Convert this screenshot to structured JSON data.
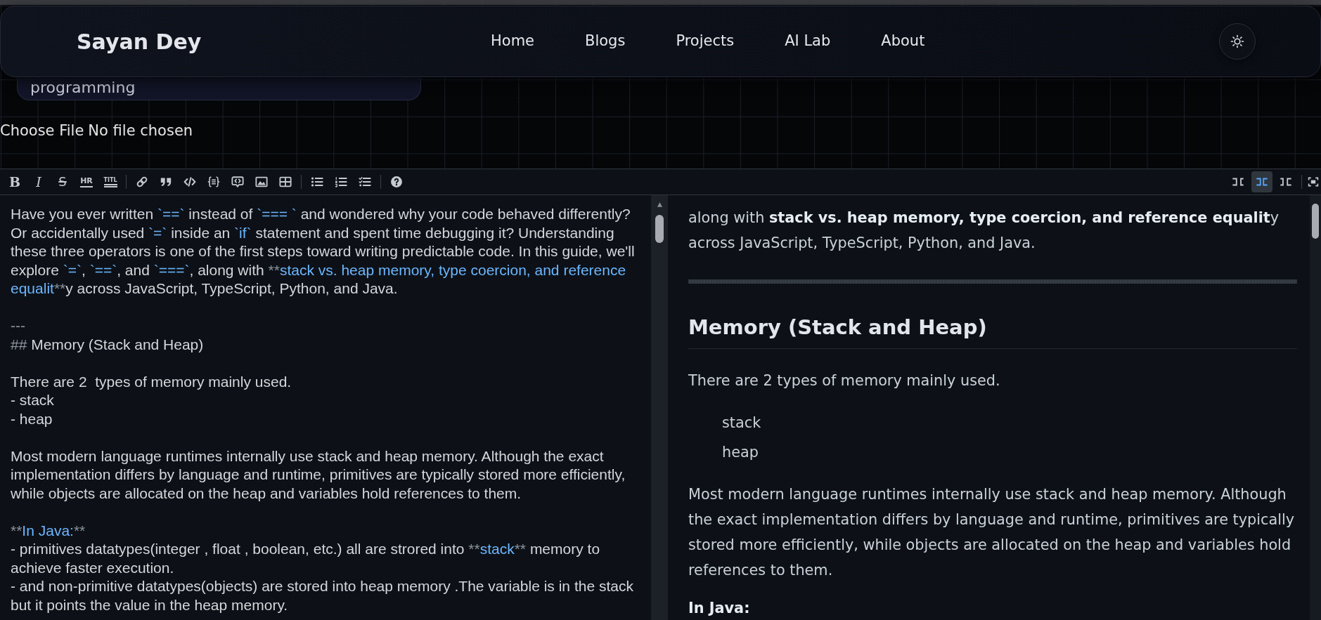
{
  "header": {
    "brand": "Sayan Dey",
    "nav": [
      "Home",
      "Blogs",
      "Projects",
      "AI Lab",
      "About"
    ]
  },
  "dropdown": {
    "items": [
      "programming"
    ]
  },
  "file_input": {
    "button": "Choose File",
    "status": "No file chosen"
  },
  "toolbar": {
    "groups": [
      [
        {
          "kind": "bold",
          "glyph": "B"
        },
        {
          "kind": "italic",
          "glyph": "I"
        },
        {
          "kind": "strikethrough",
          "glyph": "S"
        },
        {
          "kind": "rule",
          "glyph": "HR"
        },
        {
          "kind": "title",
          "glyph": "TITL"
        }
      ],
      [
        {
          "kind": "link"
        },
        {
          "kind": "quote"
        },
        {
          "kind": "code"
        },
        {
          "kind": "code_block"
        },
        {
          "kind": "comment"
        },
        {
          "kind": "image"
        },
        {
          "kind": "table"
        }
      ],
      [
        {
          "kind": "unordered_list"
        },
        {
          "kind": "ordered_list"
        },
        {
          "kind": "checked_list"
        }
      ],
      [
        {
          "kind": "help"
        }
      ]
    ],
    "view_modes": [
      {
        "kind": "edit",
        "selected": false
      },
      {
        "kind": "live",
        "selected": true
      },
      {
        "kind": "preview",
        "selected": false
      }
    ]
  },
  "editor": {
    "lines": [
      {
        "kind": "text",
        "segments": [
          {
            "kind": "text",
            "text": "Have you ever written "
          },
          {
            "kind": "code",
            "text": "`==`"
          },
          {
            "kind": "text",
            "text": " instead of "
          },
          {
            "kind": "code",
            "text": "`=== `"
          },
          {
            "kind": "text",
            "text": " and wondered why your code behaved differently? Or accidentally used "
          },
          {
            "kind": "code",
            "text": "`=`"
          },
          {
            "kind": "text",
            "text": " inside an "
          },
          {
            "kind": "code",
            "text": "`if`"
          },
          {
            "kind": "text",
            "text": " statement and spent time debugging it? Understanding these three operators is one of the first steps toward writing predictable code. In this guide, we'll explore "
          },
          {
            "kind": "code",
            "text": "`=`"
          },
          {
            "kind": "text",
            "text": ", "
          },
          {
            "kind": "code",
            "text": "`==`"
          },
          {
            "kind": "text",
            "text": ", and "
          },
          {
            "kind": "code",
            "text": "`===`"
          },
          {
            "kind": "text",
            "text": ", along with "
          },
          {
            "kind": "marker",
            "text": "**"
          },
          {
            "kind": "strong",
            "text": "stack vs. heap memory, type coercion, and reference equalit"
          },
          {
            "kind": "marker",
            "text": "**"
          },
          {
            "kind": "text",
            "text": "y across JavaScript, TypeScript, Python, and Java."
          }
        ]
      },
      {
        "kind": "blank"
      },
      {
        "kind": "text",
        "segments": [
          {
            "kind": "marker",
            "text": "---"
          }
        ]
      },
      {
        "kind": "text",
        "segments": [
          {
            "kind": "marker",
            "text": "##"
          },
          {
            "kind": "text",
            "text": " Memory (Stack and Heap)"
          }
        ]
      },
      {
        "kind": "blank"
      },
      {
        "kind": "text",
        "segments": [
          {
            "kind": "text",
            "text": "There are 2  types of memory mainly used."
          }
        ]
      },
      {
        "kind": "text",
        "segments": [
          {
            "kind": "text",
            "text": "- stack"
          }
        ]
      },
      {
        "kind": "text",
        "segments": [
          {
            "kind": "text",
            "text": "- heap"
          }
        ]
      },
      {
        "kind": "blank"
      },
      {
        "kind": "text",
        "segments": [
          {
            "kind": "text",
            "text": "Most modern language runtimes internally use stack and heap memory. Although the exact implementation differs by language and runtime, primitives are typically stored more efficiently, while objects are allocated on the heap and variables hold references to them."
          }
        ]
      },
      {
        "kind": "blank"
      },
      {
        "kind": "text",
        "segments": [
          {
            "kind": "marker",
            "text": "**"
          },
          {
            "kind": "strong",
            "text": "In Java:"
          },
          {
            "kind": "marker",
            "text": "**"
          }
        ]
      },
      {
        "kind": "text",
        "segments": [
          {
            "kind": "text",
            "text": "- primitives datatypes(integer , float , boolean, etc.) all are strored into "
          },
          {
            "kind": "marker",
            "text": "**"
          },
          {
            "kind": "strong",
            "text": "stack"
          },
          {
            "kind": "marker",
            "text": "**"
          },
          {
            "kind": "text",
            "text": " memory to achieve faster execution."
          }
        ]
      },
      {
        "kind": "text",
        "segments": [
          {
            "kind": "text",
            "text": "- and non-primitive datatypes(objects) are stored into heap memory .The variable is in the stack but it points the value in the heap memory."
          }
        ]
      }
    ]
  },
  "preview": {
    "blocks": [
      {
        "kind": "paragraph",
        "text": "along with **stack vs. heap memory, type coercion, and reference equalit**y across JavaScript, TypeScript, Python, and Java."
      },
      {
        "kind": "rule"
      },
      {
        "kind": "heading",
        "text": "Memory (Stack and Heap)"
      },
      {
        "kind": "paragraph",
        "text": "There are 2 types of memory mainly used."
      },
      {
        "kind": "list",
        "items": [
          "stack",
          "heap"
        ]
      },
      {
        "kind": "paragraph",
        "text": "Most modern language runtimes internally use stack and heap memory. Although the exact implementation differs by language and runtime, primitives are typically stored more efficiently, while objects are allocated on the heap and variables hold references to them."
      },
      {
        "kind": "strong",
        "text": "In Java:"
      }
    ]
  }
}
